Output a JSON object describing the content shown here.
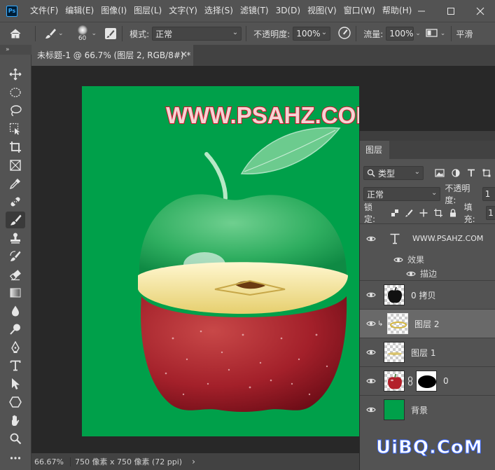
{
  "menubar": {
    "logo": "Ps",
    "items": [
      "文件(F)",
      "编辑(E)",
      "图像(I)",
      "图层(L)",
      "文字(Y)",
      "选择(S)",
      "滤镜(T)",
      "3D(D)",
      "视图(V)",
      "窗口(W)",
      "帮助(H)"
    ]
  },
  "options": {
    "brush_size": "60",
    "mode_label": "模式:",
    "mode_value": "正常",
    "opacity_label": "不透明度:",
    "opacity_value": "100%",
    "flow_label": "流量:",
    "flow_value": "100%",
    "smoothing_label": "平滑"
  },
  "document": {
    "tab_title": "未标题-1 @ 66.7% (图层 2, RGB/8#) *",
    "canvas_color": "#00a04a",
    "canvas_text": "WWW.PSAHZ.COM"
  },
  "status": {
    "zoom": "66.67%",
    "doc_info": "750 像素 x 750 像素 (72 ppi)"
  },
  "layers_panel": {
    "tab": "图层",
    "filter_kind": "类型",
    "blend_mode": "正常",
    "opacity_label": "不透明度:",
    "opacity_value": "1",
    "lock_label": "锁定:",
    "fill_label": "填充:",
    "fill_value": "1",
    "layers": [
      {
        "name": "WWW.PSAHZ.COM",
        "type": "text",
        "effects_label": "效果",
        "effect": "描边"
      },
      {
        "name": "0 拷贝",
        "type": "image"
      },
      {
        "name": "图层 2",
        "type": "image",
        "selected": true
      },
      {
        "name": "图层 1",
        "type": "image"
      },
      {
        "name": "0",
        "type": "masked"
      },
      {
        "name": "背景",
        "type": "fill"
      }
    ]
  },
  "watermark": "UiBQ.CoM"
}
